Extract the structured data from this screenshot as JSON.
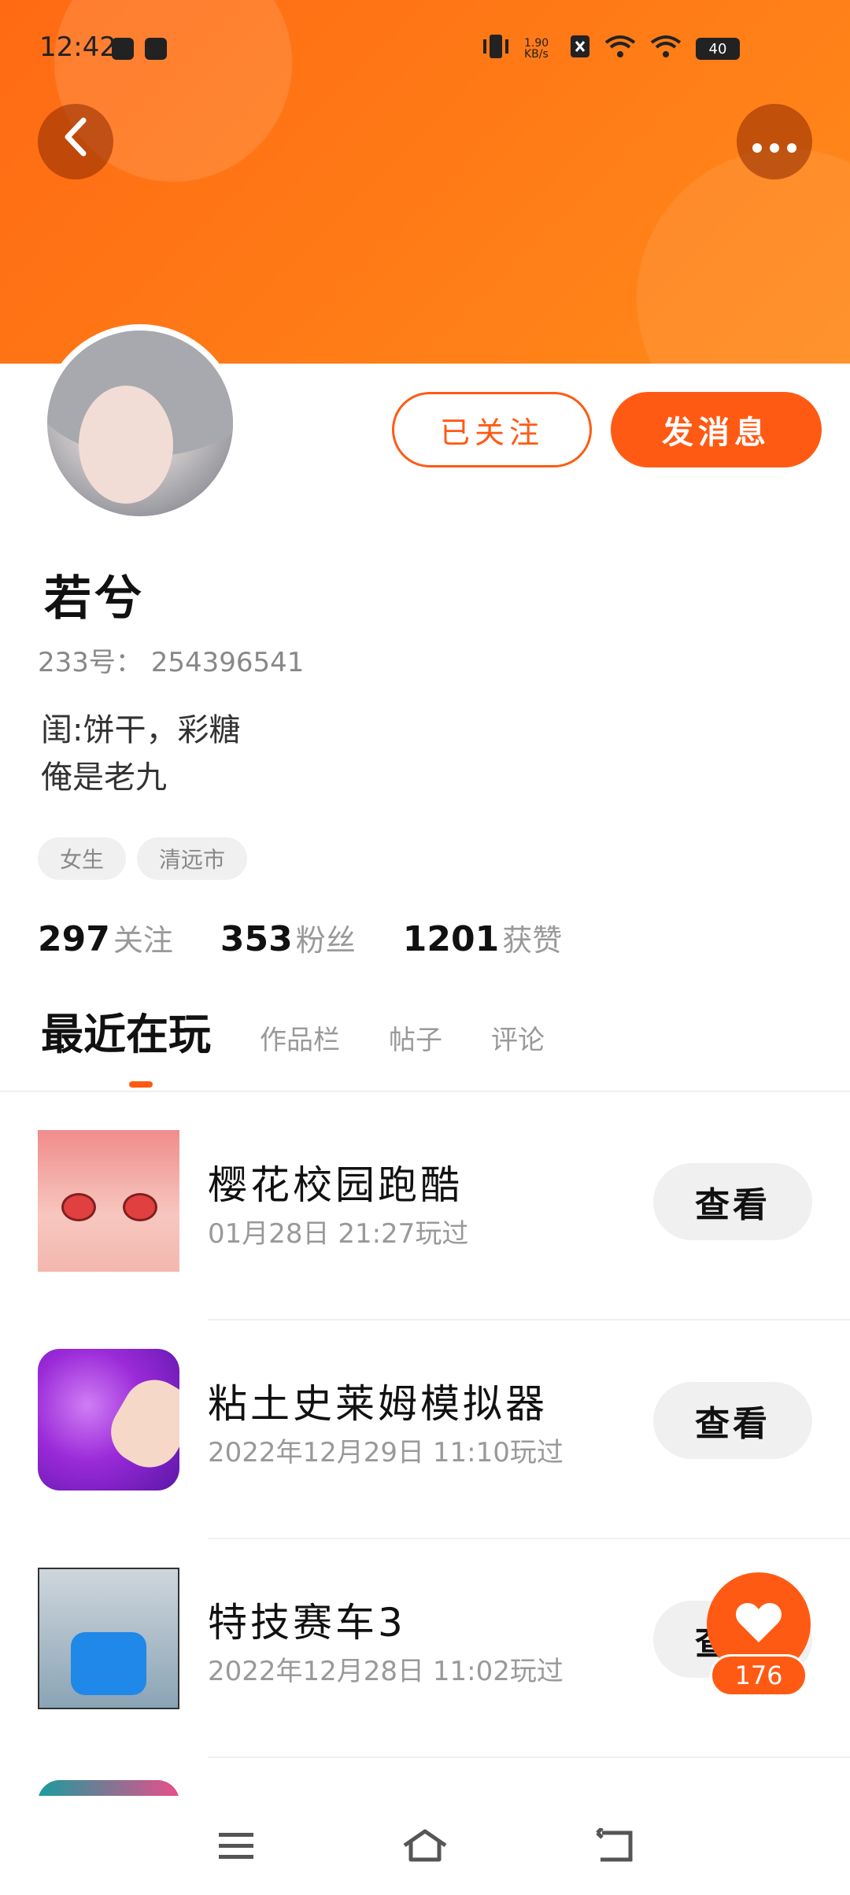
{
  "status_bar": {
    "time": "12:42",
    "net_speed": "1.90 KB/s",
    "battery": "40"
  },
  "profile": {
    "name": "若兮",
    "id_line": "233号： 254396541",
    "bio": [
      "闺:饼干，彩糖",
      "俺是老九"
    ],
    "tags": [
      "女生",
      "清远市"
    ],
    "buttons": {
      "followed": "已关注",
      "message": "发消息"
    },
    "stats": [
      {
        "value": "297",
        "label": "关注"
      },
      {
        "value": "353",
        "label": "粉丝"
      },
      {
        "value": "1201",
        "label": "获赞"
      }
    ]
  },
  "tabs": [
    "最近在玩",
    "作品栏",
    "帖子",
    "评论"
  ],
  "games": [
    {
      "title": "樱花校园跑酷",
      "played": "01月28日 21:27玩过",
      "action": "查看",
      "icon": "sakura-game-icon"
    },
    {
      "title": "粘土史莱姆模拟器",
      "played": "2022年12月29日 11:10玩过",
      "action": "查看",
      "icon": "slime-game-icon"
    },
    {
      "title": "特技赛车3",
      "played": "2022年12月28日 11:02玩过",
      "action": "查看",
      "icon": "racing-game-icon"
    }
  ],
  "like": {
    "count": "176"
  },
  "colors": {
    "accent": "#ff5a14",
    "header_start": "#ff6a13",
    "header_end": "#ff8a1a"
  }
}
